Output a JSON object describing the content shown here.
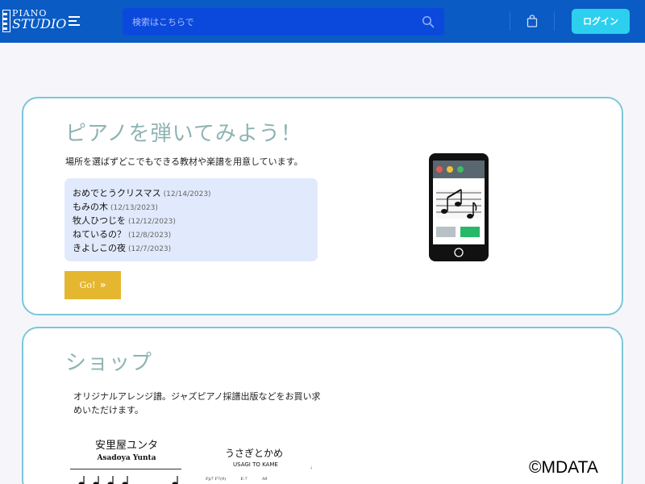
{
  "header": {
    "logo_line1": "PIANO",
    "logo_line2": "STUDIO",
    "search_placeholder": "検索はこちらで",
    "login_label": "ログイン"
  },
  "colors": {
    "header_bg": "#0a5bc4",
    "search_bg": "#0b49dc",
    "login_bg": "#2cd0ee",
    "card_border": "#7cc7d9",
    "title_color": "#8fb3b3",
    "go_bg": "#e5b731",
    "songs_bg": "#e1eafc"
  },
  "icons": [
    "piano-logo-icon",
    "hamburger-menu-icon",
    "search-icon",
    "shopping-bag-icon",
    "double-chevron-right-icon",
    "smartphone-sheet-music-icon"
  ],
  "hero": {
    "title": "ピアノを弾いてみよう！",
    "description": "場所を選ばずどこでもできる教材や楽譜を用意しています。",
    "songs": [
      {
        "title": "おめでとうクリスマス",
        "date": "(12/14/2023)"
      },
      {
        "title": "もみの木",
        "date": "(12/13/2023)"
      },
      {
        "title": "牧人ひつじを",
        "date": "(12/12/2023)"
      },
      {
        "title": "ねているの？",
        "date": "(12/8/2023)"
      },
      {
        "title": "きよしこの夜",
        "date": "(12/7/2023)"
      }
    ],
    "go_label": "Go!"
  },
  "shop": {
    "title": "ショップ",
    "description": "オリジナルアレンジ譜。ジャズピアノ採譜出版などをお買い求めいただけます。",
    "sheets": [
      {
        "title": "安里屋ユンタ",
        "subtitle": "Asadoya Yunta"
      },
      {
        "title": "うさぎとかめ",
        "subtitle": "USAGI TO KAME",
        "chords": [
          "Fp7 F7(9)",
          "E-7",
          "A9"
        ]
      }
    ]
  },
  "watermark": "©MDATA"
}
